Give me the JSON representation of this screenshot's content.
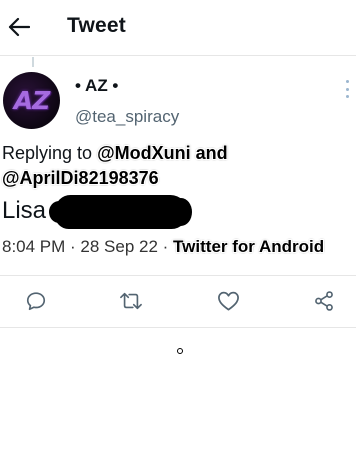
{
  "header": {
    "back_icon": "arrow-left-icon",
    "title": "Tweet"
  },
  "tweet": {
    "avatar_text": "AZ",
    "display_name": "• AZ •",
    "handle": "@tea_spiracy",
    "reply_prefix": "Replying to ",
    "reply_mention_1": "@ModXuni",
    "reply_joiner": " and",
    "reply_mention_2": "@AprilDi82198376",
    "text_visible": "Lisa",
    "time": "8:04 PM",
    "separator": " · ",
    "date": "28 Sep 22",
    "source": "Twitter for Android"
  },
  "actions": [
    {
      "name": "reply",
      "icon": "comment-icon"
    },
    {
      "name": "retweet",
      "icon": "retweet-icon"
    },
    {
      "name": "like",
      "icon": "heart-icon"
    },
    {
      "name": "share",
      "icon": "share-icon"
    }
  ],
  "colors": {
    "text": "#0f1419",
    "secondary": "#536471",
    "icon": "#536471",
    "divider": "#e6e6e6"
  }
}
